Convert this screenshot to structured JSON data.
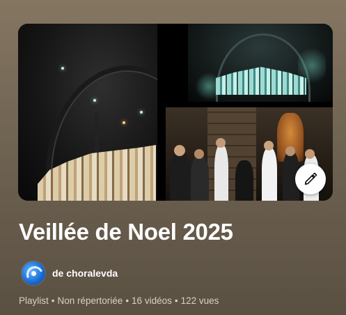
{
  "playlist": {
    "title": "Veillée de Noel 2025",
    "channel": "de choralevda",
    "meta": {
      "type": "Playlist",
      "visibility": "Non répertoriée",
      "video_count": "16 vidéos",
      "views": "122 vues",
      "separator": "•"
    }
  },
  "icons": {
    "edit": "pencil-icon"
  },
  "colors": {
    "background": "#6f6352",
    "title": "#ffffff",
    "meta": "#d9d1c4",
    "edit_button_bg": "#ffffff"
  }
}
